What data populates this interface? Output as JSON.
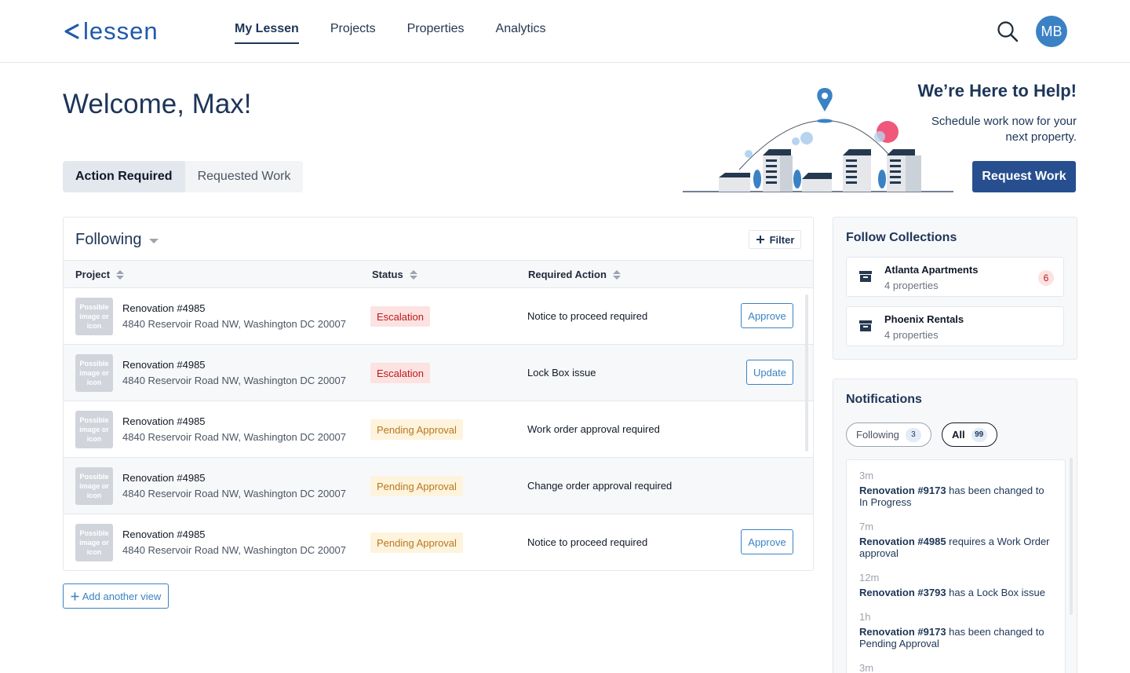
{
  "header": {
    "logo_text": "lessen",
    "nav": [
      {
        "label": "My Lessen",
        "active": true
      },
      {
        "label": "Projects",
        "active": false
      },
      {
        "label": "Properties",
        "active": false
      },
      {
        "label": "Analytics",
        "active": false
      }
    ],
    "avatar_initials": "MB"
  },
  "welcome": "Welcome, Max!",
  "tabs": [
    "Action Required",
    "Requested Work"
  ],
  "help": {
    "title": "We’re Here to Help!",
    "subtitle": "Schedule work now for your next property.",
    "button": "Request Work"
  },
  "table": {
    "title": "Following",
    "filter_label": "Filter",
    "columns": [
      "Project",
      "Status",
      "Required Action"
    ],
    "thumb_placeholder": "Possible image or icon",
    "rows": [
      {
        "name": "Renovation #4985",
        "address": "4840 Reservoir Road NW, Washington DC 20007",
        "status": "Escalation",
        "action": "Notice to proceed required",
        "button": "Approve"
      },
      {
        "name": "Renovation #4985",
        "address": "4840 Reservoir Road NW, Washington DC 20007",
        "status": "Escalation",
        "action": "Lock Box issue",
        "button": "Update"
      },
      {
        "name": "Renovation #4985",
        "address": "4840 Reservoir Road NW, Washington DC 20007",
        "status": "Pending Approval",
        "action": "Work order approval required",
        "button": ""
      },
      {
        "name": "Renovation #4985",
        "address": "4840 Reservoir Road NW, Washington DC 20007",
        "status": "Pending Approval",
        "action": "Change order approval required",
        "button": ""
      },
      {
        "name": "Renovation #4985",
        "address": "4840 Reservoir Road NW, Washington DC 20007",
        "status": "Pending Approval",
        "action": "Notice to proceed required",
        "button": "Approve"
      }
    ],
    "add_view": "Add another view"
  },
  "collections": {
    "title": "Follow Collections",
    "items": [
      {
        "name": "Atlanta Apartments",
        "count": "4 properties",
        "badge": "6"
      },
      {
        "name": "Phoenix Rentals",
        "count": "4 properties",
        "badge": ""
      }
    ]
  },
  "notifications": {
    "title": "Notifications",
    "filters": [
      {
        "label": "Following",
        "count": "3"
      },
      {
        "label": "All",
        "count": "99"
      }
    ],
    "items": [
      {
        "time": "3m",
        "bold": "Renovation #9173",
        "text": " has been changed to In Progress"
      },
      {
        "time": "7m",
        "bold": "Renovation #4985",
        "text": " requires a Work Order approval"
      },
      {
        "time": "12m",
        "bold": "Renovation #3793",
        "text": " has a Lock Box issue"
      },
      {
        "time": "1h",
        "bold": "Renovation #9173",
        "text": " has been changed to Pending Approval"
      },
      {
        "time": "3m",
        "bold": "",
        "text": ""
      }
    ]
  },
  "colors": {
    "brand": "#1f5aa8",
    "primary_button": "#274f8f",
    "escalation": "#b91c1c",
    "pending": "#b7791f"
  }
}
